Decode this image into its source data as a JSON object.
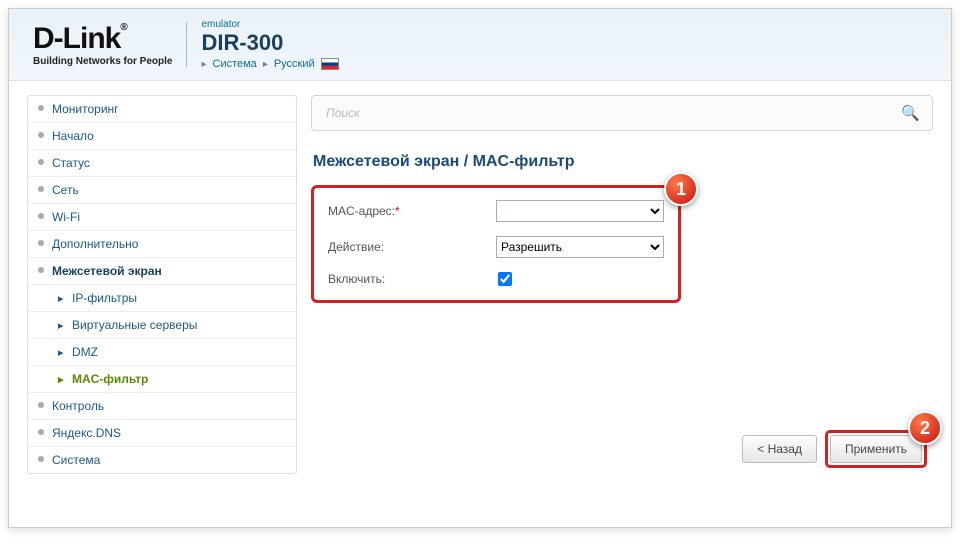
{
  "header": {
    "logo_main": "D-Link",
    "logo_tag": "Building Networks for People",
    "emulator": "emulator",
    "model": "DIR-300",
    "breadcrumb": {
      "item1": "Система",
      "item2": "Русский"
    }
  },
  "sidebar": {
    "items": [
      {
        "label": "Мониторинг",
        "type": "top"
      },
      {
        "label": "Начало",
        "type": "top"
      },
      {
        "label": "Статус",
        "type": "top"
      },
      {
        "label": "Сеть",
        "type": "top"
      },
      {
        "label": "Wi-Fi",
        "type": "top"
      },
      {
        "label": "Дополнительно",
        "type": "top"
      },
      {
        "label": "Межсетевой экран",
        "type": "top",
        "active": true
      },
      {
        "label": "IP-фильтры",
        "type": "sub"
      },
      {
        "label": "Виртуальные серверы",
        "type": "sub"
      },
      {
        "label": "DMZ",
        "type": "sub"
      },
      {
        "label": "MAC-фильтр",
        "type": "sub",
        "active_sub": true
      },
      {
        "label": "Контроль",
        "type": "top"
      },
      {
        "label": "Яндекс.DNS",
        "type": "top"
      },
      {
        "label": "Система",
        "type": "top"
      }
    ]
  },
  "search": {
    "placeholder": "Поиск"
  },
  "page": {
    "title": "Межсетевой экран /  MAC-фильтр",
    "form": {
      "mac_label": "MAC-адрес:",
      "mac_value": "",
      "action_label": "Действие:",
      "action_value": "Разрешить",
      "action_options": [
        "Разрешить"
      ],
      "enable_label": "Включить:",
      "enable_checked": true
    },
    "buttons": {
      "back": "< Назад",
      "apply": "Применить"
    }
  },
  "callouts": {
    "c1": "1",
    "c2": "2"
  }
}
